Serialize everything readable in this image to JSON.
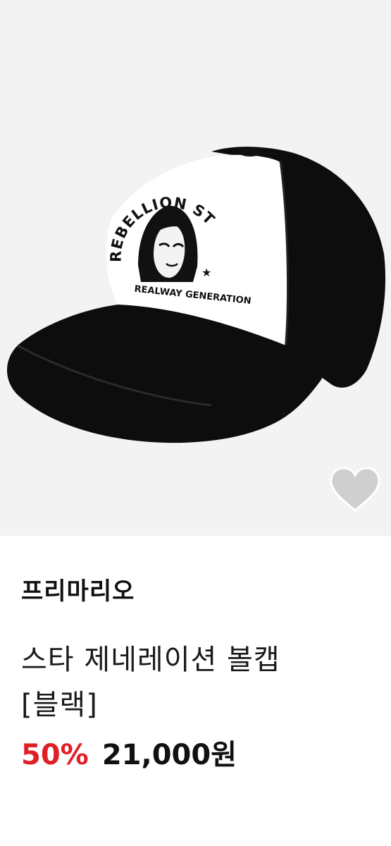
{
  "product": {
    "brand": "프리마리오",
    "title_line1": "스타 제네레이션 볼캡",
    "title_line2": "[블랙]",
    "discount": "50%",
    "price": "21,000원"
  },
  "image": {
    "embroidery_arc_text": "REBELLION STAR",
    "embroidery_bottom_text": "REALWAY GENERATION",
    "embroidery_star": "★"
  },
  "icons": {
    "wish": "heart-icon"
  },
  "colors": {
    "discount": "#e01f26",
    "image_background": "#f3f3f3",
    "heart": "#cfcfcf"
  }
}
